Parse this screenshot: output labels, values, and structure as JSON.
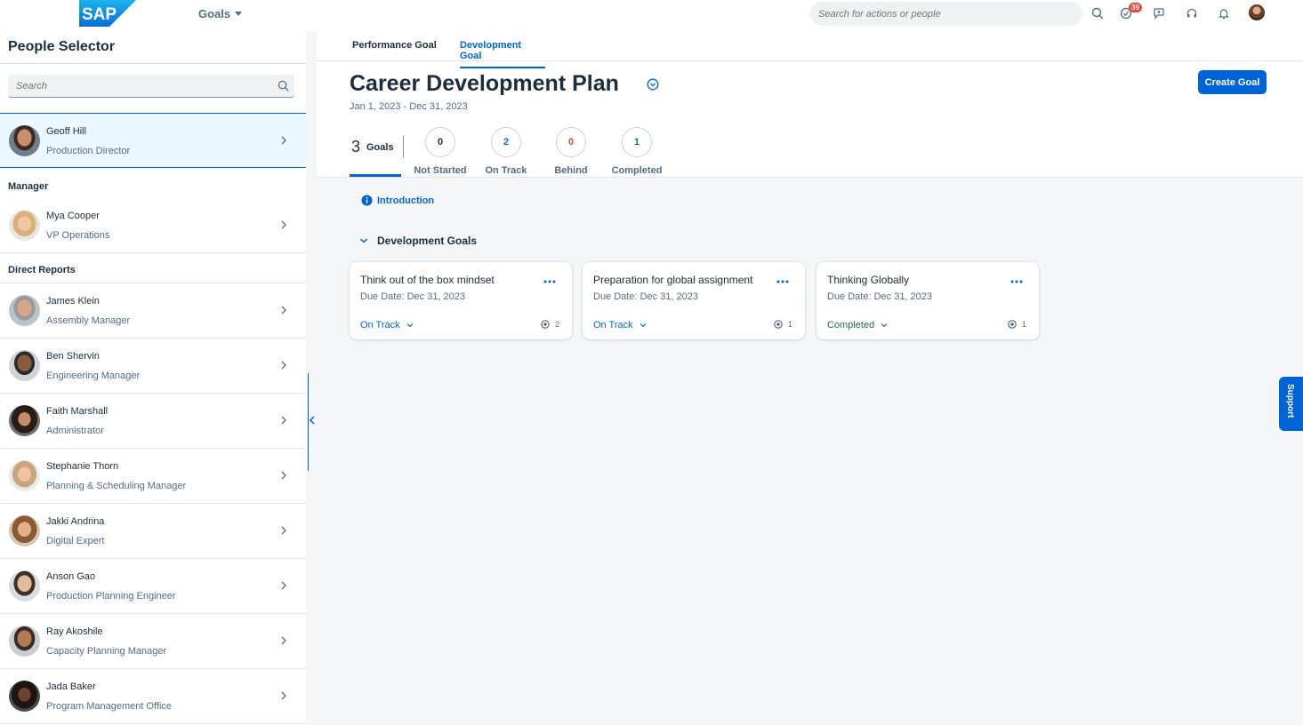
{
  "shell": {
    "logo_text": "SAP",
    "menu_label": "Goals",
    "search_placeholder": "Search for actions or people",
    "notification_count": "39"
  },
  "people_selector": {
    "title": "People Selector",
    "search_placeholder": "Search",
    "selected": {
      "name": "Geoff Hill",
      "role": "Production Director"
    },
    "manager_label": "Manager",
    "manager": {
      "name": "Mya Cooper",
      "role": "VP Operations"
    },
    "direct_reports_label": "Direct Reports",
    "direct_reports": [
      {
        "name": "James Klein",
        "role": "Assembly Manager"
      },
      {
        "name": "Ben Shervin",
        "role": "Engineering Manager"
      },
      {
        "name": "Faith Marshall",
        "role": "Administrator"
      },
      {
        "name": "Stephanie Thorn",
        "role": "Planning & Scheduling Manager"
      },
      {
        "name": "Jakki Andrina",
        "role": "Digital Expert"
      },
      {
        "name": "Anson Gao",
        "role": "Production Planning Engineer"
      },
      {
        "name": "Ray Akoshile",
        "role": "Capacity Planning Manager"
      },
      {
        "name": "Jada Baker",
        "role": "Program Management Office"
      }
    ]
  },
  "tabs": [
    {
      "label": "Performance Goal"
    },
    {
      "label": "Development Goal"
    }
  ],
  "plan": {
    "title": "Career Development Plan",
    "dates": "Jan 1, 2023 - Dec 31, 2023",
    "create_label": "Create Goal"
  },
  "summary": {
    "total": "3",
    "total_label": "Goals",
    "stats": [
      {
        "value": "0",
        "label": "Not Started",
        "color": "#1d2d3e"
      },
      {
        "value": "2",
        "label": "On Track",
        "color": "#0064d9"
      },
      {
        "value": "0",
        "label": "Behind",
        "color": "#e64b3b"
      },
      {
        "value": "1",
        "label": "Completed",
        "color": "#256f3a"
      }
    ]
  },
  "intro_label": "Introduction",
  "section_title": "Development Goals",
  "goals": [
    {
      "title": "Think out of the box mindset",
      "due": "Due Date: Dec 31, 2023",
      "status": "On Track",
      "status_color": "#0064d9",
      "count": "2"
    },
    {
      "title": "Preparation for global assignment",
      "due": "Due Date: Dec 31, 2023",
      "status": "On Track",
      "status_color": "#0064d9",
      "count": "1"
    },
    {
      "title": "Thinking Globally",
      "due": "Due Date: Dec 31, 2023",
      "status": "Completed",
      "status_color": "#256f3a",
      "count": "1"
    }
  ],
  "support_label": "Support",
  "icons": {
    "search": "search-icon",
    "tasks": "check-circle-icon",
    "feedback": "feedback-icon",
    "help": "headset-icon",
    "notifications": "bell-icon",
    "chevron": "chevron-right-icon",
    "info": "info-icon",
    "more": "more-icon",
    "goal_link": "link-icon"
  },
  "colors": {
    "accent": "#0064d9",
    "behind": "#e64b3b",
    "completed": "#256f3a"
  }
}
